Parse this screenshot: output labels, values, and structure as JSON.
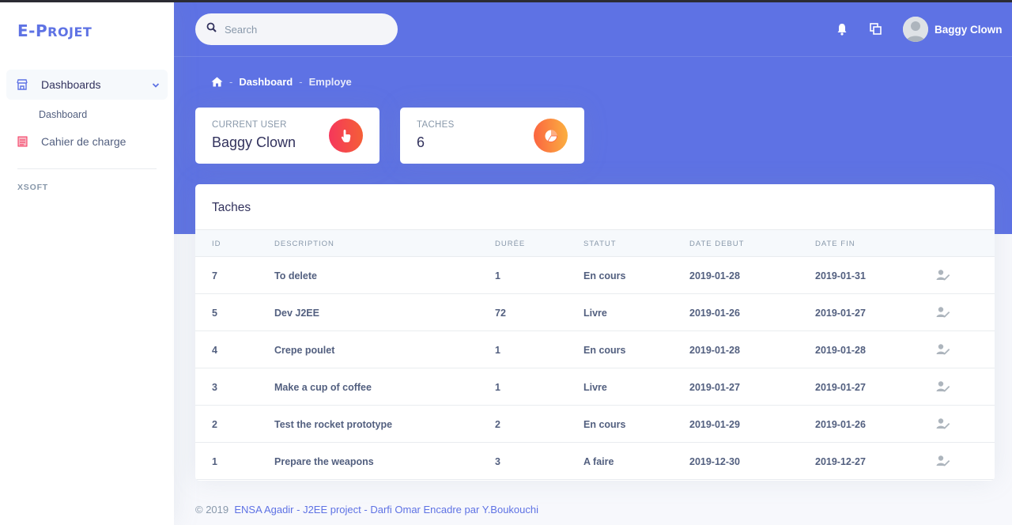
{
  "brand": {
    "name_main": "E-P",
    "name_small": "ROJET"
  },
  "sidebar": {
    "items": [
      {
        "label": "Dashboards",
        "icon": "store-icon"
      },
      {
        "label": "Cahier de charge",
        "icon": "document-icon"
      }
    ],
    "subitem": "Dashboard",
    "heading": "XSOFT"
  },
  "search": {
    "placeholder": "Search"
  },
  "user": {
    "name": "Baggy Clown"
  },
  "breadcrumb": {
    "item1": "Dashboard",
    "item2": "Employe"
  },
  "stats": [
    {
      "label": "Current user",
      "value": "Baggy Clown",
      "color": "#f5365c"
    },
    {
      "label": "Taches",
      "value": "6",
      "color": "#fb6340"
    }
  ],
  "table": {
    "title": "Taches",
    "columns": [
      "ID",
      "DESCRIPTION",
      "DURÉE",
      "STATUT",
      "DATE DEBUT",
      "DATE FIN"
    ],
    "rows": [
      [
        "7",
        "To delete",
        "1",
        "En cours",
        "2019-01-28",
        "2019-01-31"
      ],
      [
        "5",
        "Dev J2EE",
        "72",
        "Livre",
        "2019-01-26",
        "2019-01-27"
      ],
      [
        "4",
        "Crepe poulet",
        "1",
        "En cours",
        "2019-01-28",
        "2019-01-28"
      ],
      [
        "3",
        "Make a cup of coffee",
        "1",
        "Livre",
        "2019-01-27",
        "2019-01-27"
      ],
      [
        "2",
        "Test the rocket prototype",
        "2",
        "En cours",
        "2019-01-29",
        "2019-01-26"
      ],
      [
        "1",
        "Prepare the weapons",
        "3",
        "A faire",
        "2019-12-30",
        "2019-12-27"
      ]
    ]
  },
  "footer": {
    "copyright": "© 2019",
    "link": "ENSA Agadir - J2EE project - Darfi Omar Encadre par Y.Boukouchi"
  },
  "colors": {
    "primary": "#5e72e4",
    "danger": "#f5365c",
    "warning": "#fb6340"
  }
}
